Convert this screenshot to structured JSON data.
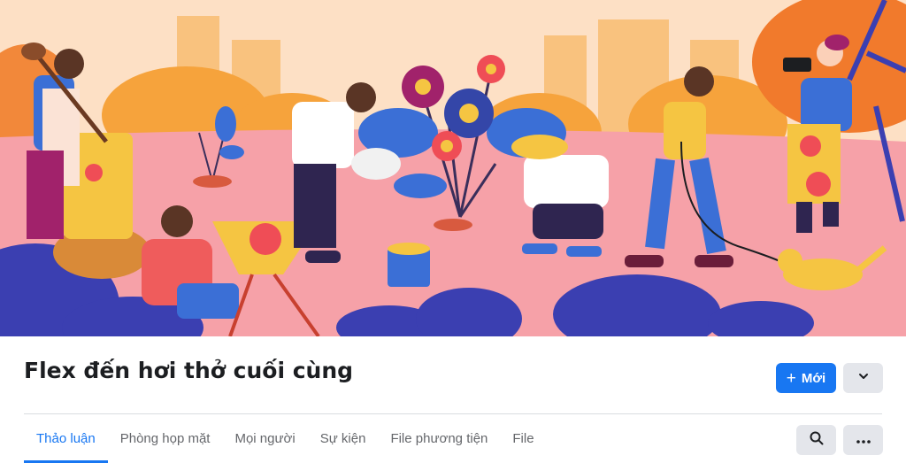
{
  "group": {
    "title": "Flex đến hơi thở cuối cùng"
  },
  "actions": {
    "new_label": "Mới",
    "new_icon": "plus-icon",
    "dropdown_icon": "chevron-down-icon"
  },
  "tabs": [
    {
      "label": "Thảo luận",
      "active": true
    },
    {
      "label": "Phòng họp mặt",
      "active": false
    },
    {
      "label": "Mọi người",
      "active": false
    },
    {
      "label": "Sự kiện",
      "active": false
    },
    {
      "label": "File phương tiện",
      "active": false
    },
    {
      "label": "File",
      "active": false
    }
  ],
  "toolbar": {
    "search_icon": "search-icon",
    "more_icon": "more-horizontal-icon"
  },
  "colors": {
    "accent": "#1877f2",
    "button_gray": "#e4e6eb",
    "text_primary": "#1c1e21",
    "text_secondary": "#65676b"
  }
}
